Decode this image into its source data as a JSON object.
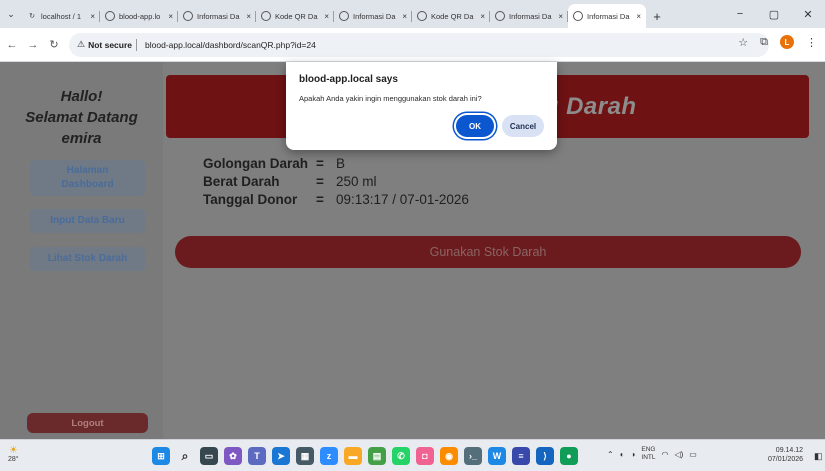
{
  "browser": {
    "tabs": [
      {
        "label": "localhost / 1",
        "icon": "refresh-icon",
        "active": false
      },
      {
        "label": "blood-app.lo",
        "icon": "globe-icon",
        "active": false
      },
      {
        "label": "Informasi Da",
        "icon": "globe-icon",
        "active": false
      },
      {
        "label": "Kode QR Da",
        "icon": "globe-icon",
        "active": false
      },
      {
        "label": "Informasi Da",
        "icon": "globe-icon",
        "active": false
      },
      {
        "label": "Kode QR Da",
        "icon": "globe-icon",
        "active": false
      },
      {
        "label": "Informasi Da",
        "icon": "globe-icon",
        "active": false
      },
      {
        "label": "Informasi Da",
        "icon": "globe-icon",
        "active": true
      }
    ],
    "close_glyph": "×",
    "new_tab": "+",
    "window_controls": {
      "minimize": "−",
      "restore": "▢",
      "close": "✕"
    },
    "address": {
      "security_label": "Not secure",
      "url": "blood-app.local/dashbord/scanQR.php?id=24"
    },
    "profile_initial": "L"
  },
  "sidebar": {
    "greeting": [
      "Hallo!",
      "Selamat Datang",
      "emira"
    ],
    "items": [
      {
        "label": "Halaman Dashboard"
      },
      {
        "label": "Input Data Baru"
      },
      {
        "label": "Lihat Stok Darah"
      }
    ],
    "logout_label": "Logout"
  },
  "main": {
    "banner_title": "Informasi Kantong Darah",
    "details": [
      {
        "label": "Golongan Darah",
        "sep": "=",
        "value": "B"
      },
      {
        "label": "Berat Darah",
        "sep": "=",
        "value": "250 ml"
      },
      {
        "label": "Tanggal Donor",
        "sep": "=",
        "value": "09:13:17 / 07-01-2026"
      }
    ],
    "use_button": "Gunakan Stok Darah"
  },
  "dialog": {
    "title": "blood-app.local says",
    "message": "Apakah Anda yakin ingin menggunakan stok darah ini?",
    "ok_label": "OK",
    "cancel_label": "Cancel"
  },
  "taskbar": {
    "weather_temp": "28°",
    "tray_lang": [
      "ENG",
      "INTL"
    ],
    "time": "09.14.12",
    "date": "07/01/2026"
  },
  "colors": {
    "accent": "#0b57d0",
    "banner": "#b81c20",
    "overlay": "rgba(0,0,0,0.5)"
  }
}
